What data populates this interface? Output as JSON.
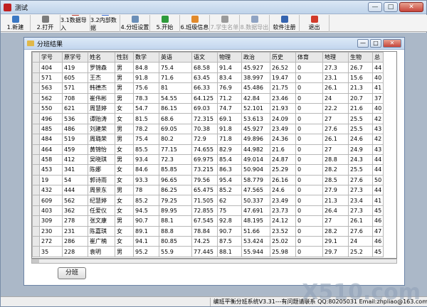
{
  "window": {
    "title": "测试",
    "btn_min": "—",
    "btn_max": "□",
    "btn_close": "✕"
  },
  "toolbar": [
    {
      "label": "1.新建",
      "icon": "new-icon",
      "color": "#3b78c4",
      "disabled": false
    },
    {
      "label": "2.打开",
      "icon": "open-icon",
      "color": "#7c7c7c",
      "disabled": false
    },
    {
      "label": "3.1数据导入",
      "icon": "import-icon",
      "color": "#c0392b",
      "disabled": false
    },
    {
      "label": "3.2内部数据",
      "icon": "data-icon",
      "color": "#3a6fd8",
      "disabled": false
    },
    {
      "label": "4.分班设置",
      "icon": "settings-icon",
      "color": "#6b8fb8",
      "disabled": false
    },
    {
      "label": "5.开始",
      "icon": "start-icon",
      "color": "#2e9b3b",
      "disabled": false
    },
    {
      "label": "6.班级信息",
      "icon": "class-info-icon",
      "color": "#e28a2b",
      "disabled": false
    },
    {
      "label": "7.学生名单",
      "icon": "student-list-icon",
      "color": "#9a9a9a",
      "disabled": true
    },
    {
      "label": "8.数据导出",
      "icon": "export-icon",
      "color": "#8fa3c3",
      "disabled": true
    },
    {
      "label": "软件注册",
      "icon": "register-icon",
      "color": "#3564b0",
      "disabled": false
    },
    {
      "label": "退出",
      "icon": "exit-icon",
      "color": "#d23a2a",
      "disabled": false
    }
  ],
  "child": {
    "title": "分班结果",
    "btn_min": "—",
    "btn_max": "□",
    "btn_close": "✕"
  },
  "table": {
    "headers": [
      "学号",
      "原学号",
      "姓名",
      "性别",
      "数学",
      "英语",
      "语文",
      "物理",
      "政治",
      "历史",
      "体育",
      "地理",
      "生物",
      "总"
    ],
    "rows": [
      [
        "404",
        "419",
        "罗锦森",
        "男",
        "84.8",
        "75.4",
        "68.58",
        "91.4",
        "45.927",
        "26.52",
        "0",
        "27.3",
        "26.7",
        "44"
      ],
      [
        "571",
        "605",
        "王杰",
        "男",
        "91.8",
        "71.6",
        "63.45",
        "83.4",
        "38.997",
        "19.47",
        "0",
        "23.1",
        "15.6",
        "40"
      ],
      [
        "563",
        "571",
        "韩德杰",
        "男",
        "75.6",
        "81",
        "66.33",
        "76.9",
        "45.486",
        "21.75",
        "0",
        "26.1",
        "21.3",
        "41"
      ],
      [
        "562",
        "708",
        "崔伟彬",
        "男",
        "78.3",
        "54.55",
        "64.125",
        "71.2",
        "42.84",
        "23.46",
        "0",
        "24",
        "20.7",
        "37"
      ],
      [
        "550",
        "621",
        "周慧婷",
        "女",
        "54.7",
        "86.15",
        "69.03",
        "74.7",
        "52.101",
        "21.93",
        "0",
        "22.2",
        "21.6",
        "40"
      ],
      [
        "496",
        "536",
        "谭贻涛",
        "女",
        "81.5",
        "68.6",
        "72.315",
        "69.1",
        "53.613",
        "24.09",
        "0",
        "27",
        "25.5",
        "42"
      ],
      [
        "485",
        "486",
        "刘建荣",
        "男",
        "78.2",
        "69.05",
        "70.38",
        "91.8",
        "45.927",
        "23.49",
        "0",
        "27.6",
        "25.5",
        "43"
      ],
      [
        "484",
        "519",
        "周璐荣",
        "男",
        "75.4",
        "80.2",
        "72.9",
        "71.8",
        "49.896",
        "24.36",
        "0",
        "26.1",
        "24.6",
        "42"
      ],
      [
        "464",
        "459",
        "黄锦怡",
        "女",
        "85.5",
        "77.15",
        "74.655",
        "82.9",
        "44.982",
        "21.6",
        "0",
        "27",
        "24.9",
        "43"
      ],
      [
        "458",
        "412",
        "吴晓琪",
        "男",
        "93.4",
        "72.3",
        "69.975",
        "85.4",
        "49.014",
        "24.87",
        "0",
        "28.8",
        "24.3",
        "44"
      ],
      [
        "453",
        "341",
        "陈娜",
        "女",
        "84.6",
        "85.85",
        "73.215",
        "86.3",
        "50.904",
        "25.29",
        "0",
        "28.2",
        "25.5",
        "44"
      ],
      [
        "19",
        "54",
        "郭诗雨",
        "女",
        "93.3",
        "96.65",
        "79.56",
        "95.4",
        "58.779",
        "26.16",
        "0",
        "28.5",
        "27.6",
        "50"
      ],
      [
        "432",
        "444",
        "周景东",
        "男",
        "78",
        "86.25",
        "65.475",
        "85.2",
        "47.565",
        "24.6",
        "0",
        "27.9",
        "27.3",
        "44"
      ],
      [
        "609",
        "562",
        "纪慧婷",
        "女",
        "85.2",
        "79.25",
        "71.505",
        "62",
        "50.337",
        "23.49",
        "0",
        "21.3",
        "23.4",
        "41"
      ],
      [
        "403",
        "362",
        "任爱仪",
        "女",
        "94.5",
        "89.95",
        "72.855",
        "75",
        "47.691",
        "23.73",
        "0",
        "26.4",
        "27.3",
        "45"
      ],
      [
        "309",
        "278",
        "张文康",
        "男",
        "90.7",
        "88.1",
        "67.545",
        "92.8",
        "48.195",
        "24.12",
        "0",
        "27",
        "26.1",
        "46"
      ],
      [
        "230",
        "231",
        "陈嘉琪",
        "女",
        "89.1",
        "88.8",
        "78.84",
        "90.7",
        "51.66",
        "23.52",
        "0",
        "28.2",
        "27.6",
        "47"
      ],
      [
        "272",
        "286",
        "崔广楠",
        "女",
        "94.1",
        "80.85",
        "74.25",
        "87.5",
        "53.424",
        "25.02",
        "0",
        "29.1",
        "24",
        "46"
      ],
      [
        "35",
        "228",
        "袁明",
        "男",
        "95.2",
        "55.9",
        "77.445",
        "88.1",
        "55.944",
        "25.98",
        "0",
        "29.7",
        "25.2",
        "45"
      ]
    ]
  },
  "fenban_button": "分班",
  "status": {
    "text": "编班平衡分班系统V3.31---有问题请联系   QQ:80205031   Email:zhpliao@163.com"
  },
  "watermark": "X510.com"
}
